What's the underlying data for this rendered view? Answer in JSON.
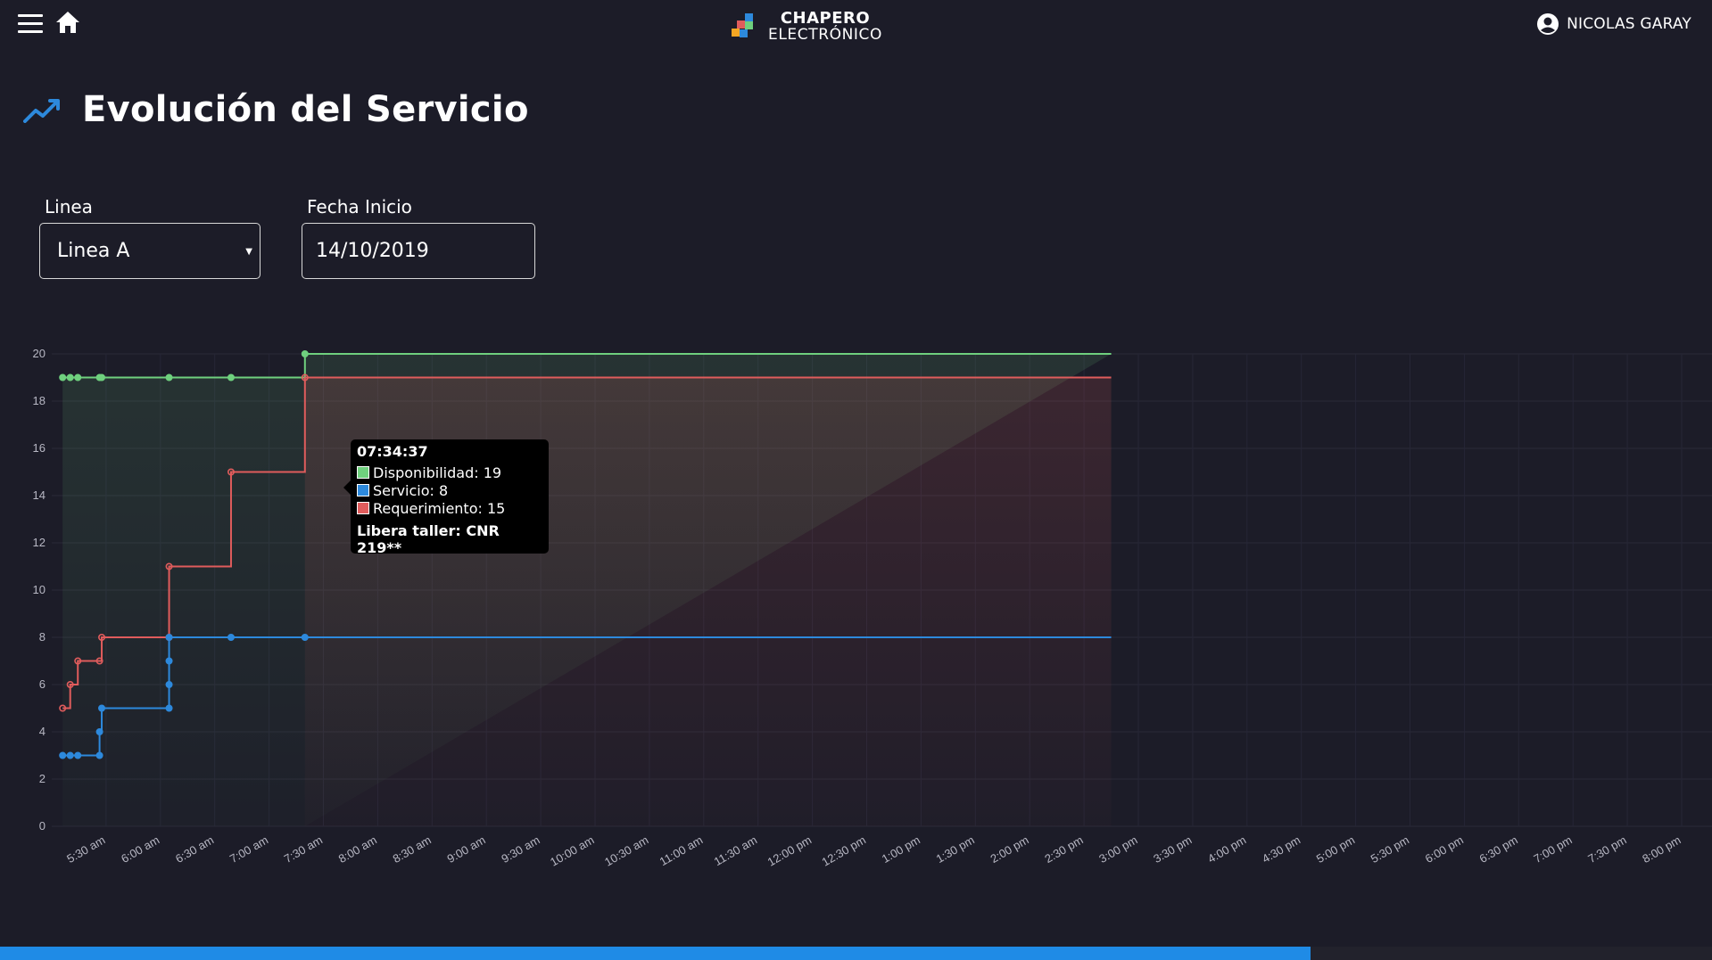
{
  "header": {
    "brand_line1": "CHAPERO",
    "brand_line2": "ELECTRÓNICO",
    "user_name": "NICOLAS GARAY"
  },
  "page": {
    "title": "Evolución del Servicio"
  },
  "filters": {
    "line_label": "Linea",
    "line_value": "Linea A",
    "date_label": "Fecha Inicio",
    "date_value": "14/10/2019"
  },
  "tooltip": {
    "time": "07:34:37",
    "rows": [
      {
        "text": "Disponibilidad: 19",
        "color": "#6fd07e"
      },
      {
        "text": "Servicio: 8",
        "color": "#2d89dc"
      },
      {
        "text": "Requerimiento: 15",
        "color": "#e05c5c"
      }
    ],
    "footer": "Libera taller: CNR 219**"
  },
  "chart_data": {
    "type": "line",
    "step": true,
    "ylim": [
      0,
      20
    ],
    "y_ticks": [
      "0",
      "2",
      "4",
      "6",
      "8",
      "10",
      "12",
      "14",
      "16",
      "18",
      "20"
    ],
    "x_ticks": [
      "5:30 am",
      "6:00 am",
      "6:30 am",
      "7:00 am",
      "7:30 am",
      "8:00 am",
      "8:30 am",
      "9:00 am",
      "9:30 am",
      "10:00 am",
      "10:30 am",
      "11:00 am",
      "11:30 am",
      "12:00 pm",
      "12:30 pm",
      "1:00 pm",
      "1:30 pm",
      "2:00 pm",
      "2:30 pm",
      "3:00 pm",
      "3:30 pm",
      "4:00 pm",
      "4:30 pm",
      "5:00 pm",
      "5:30 pm",
      "6:00 pm",
      "6:30 pm",
      "7:00 pm",
      "7:30 pm",
      "8:00 pm",
      "8"
    ],
    "x_unit": "hours",
    "grid": true,
    "series": [
      {
        "name": "Disponibilidad",
        "color": "#6fd07e",
        "points": [
          [
            5.1,
            19
          ],
          [
            5.17,
            19
          ],
          [
            5.24,
            19
          ],
          [
            5.44,
            19
          ],
          [
            5.46,
            19
          ],
          [
            6.08,
            19
          ],
          [
            6.65,
            19
          ],
          [
            7.33,
            20
          ],
          [
            14.75,
            20
          ]
        ]
      },
      {
        "name": "Requerimiento",
        "color": "#e05c5c",
        "points": [
          [
            5.1,
            5
          ],
          [
            5.17,
            6
          ],
          [
            5.24,
            7
          ],
          [
            5.44,
            7
          ],
          [
            5.46,
            8
          ],
          [
            6.08,
            8
          ],
          [
            6.08,
            11
          ],
          [
            6.65,
            15
          ],
          [
            7.33,
            19
          ],
          [
            14.75,
            19
          ]
        ]
      },
      {
        "name": "Servicio",
        "color": "#2d89dc",
        "points": [
          [
            5.1,
            3
          ],
          [
            5.17,
            3
          ],
          [
            5.24,
            3
          ],
          [
            5.44,
            3
          ],
          [
            5.44,
            4
          ],
          [
            5.46,
            5
          ],
          [
            6.08,
            5
          ],
          [
            6.08,
            6
          ],
          [
            6.08,
            7
          ],
          [
            6.08,
            8
          ],
          [
            6.65,
            8
          ],
          [
            7.33,
            8
          ],
          [
            14.75,
            8
          ]
        ]
      }
    ]
  }
}
